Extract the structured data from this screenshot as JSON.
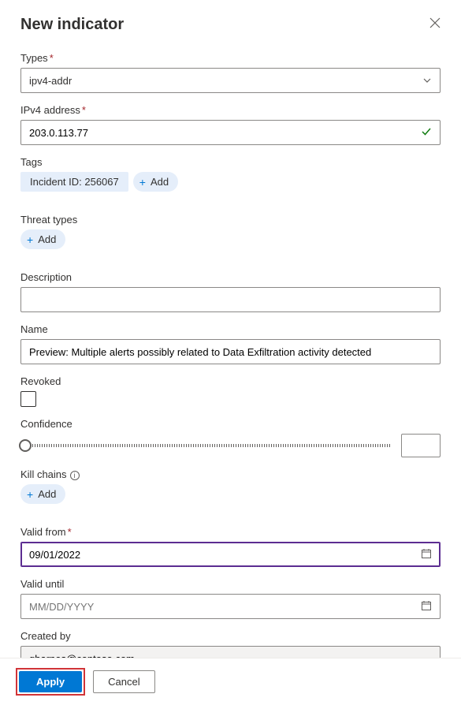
{
  "panel": {
    "title": "New indicator"
  },
  "fields": {
    "types": {
      "label": "Types",
      "required": true,
      "value": "ipv4-addr"
    },
    "ipv4": {
      "label": "IPv4 address",
      "required": true,
      "value": "203.0.113.77",
      "valid": true
    },
    "tags": {
      "label": "Tags",
      "items": [
        "Incident ID: 256067"
      ],
      "addLabel": "Add"
    },
    "threatTypes": {
      "label": "Threat types",
      "addLabel": "Add"
    },
    "description": {
      "label": "Description",
      "value": ""
    },
    "name": {
      "label": "Name",
      "value": "Preview: Multiple alerts possibly related to Data Exfiltration activity detected"
    },
    "revoked": {
      "label": "Revoked",
      "checked": false
    },
    "confidence": {
      "label": "Confidence",
      "value": ""
    },
    "killChains": {
      "label": "Kill chains",
      "addLabel": "Add"
    },
    "validFrom": {
      "label": "Valid from",
      "required": true,
      "value": "09/01/2022"
    },
    "validUntil": {
      "label": "Valid until",
      "value": "",
      "placeholder": "MM/DD/YYYY"
    },
    "createdBy": {
      "label": "Created by",
      "value": "gbarnes@contoso.com"
    }
  },
  "footer": {
    "apply": "Apply",
    "cancel": "Cancel"
  }
}
